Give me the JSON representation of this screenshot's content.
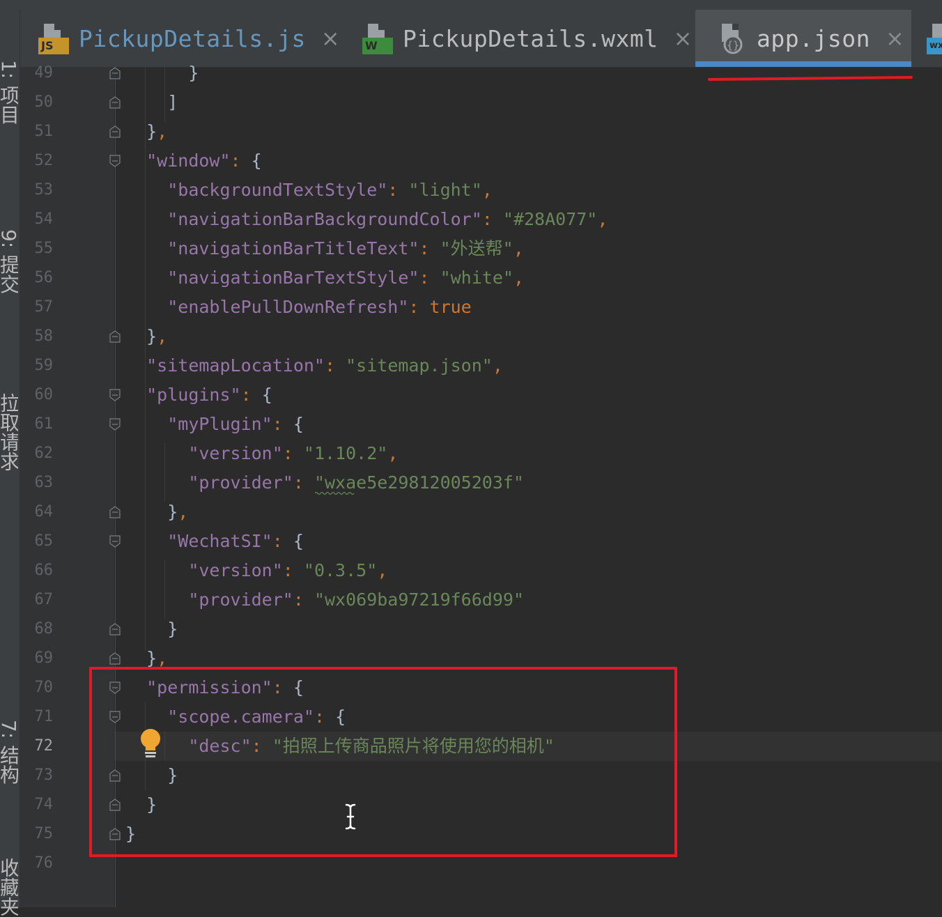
{
  "tabs": [
    {
      "label": "PickupDetails.js",
      "badge": "JS",
      "badge_color": "#c4932a",
      "close": "×"
    },
    {
      "label": "PickupDetails.wxml",
      "badge": "W",
      "badge_color": "#3d8b3d",
      "close": "×"
    },
    {
      "label": "app.json",
      "badge": "",
      "active": true,
      "close": "×"
    },
    {
      "label": "",
      "badge": "wx",
      "badge_color": "#3a96c8"
    }
  ],
  "sidebar": {
    "labels": [
      "1: 项目",
      "9: 提交",
      "拉取请求",
      "7: 结构",
      "收藏夹"
    ]
  },
  "editor": {
    "current_line": 72,
    "lines": [
      {
        "n": "49",
        "code": "      }"
      },
      {
        "n": "50",
        "code": "    ]"
      },
      {
        "n": "51",
        "code": "  },"
      },
      {
        "n": "52",
        "code": "  \"window\": {"
      },
      {
        "n": "53",
        "code": "    \"backgroundTextStyle\": \"light\","
      },
      {
        "n": "54",
        "code": "    \"navigationBarBackgroundColor\": \"#28A077\","
      },
      {
        "n": "55",
        "code": "    \"navigationBarTitleText\": \"外送帮\","
      },
      {
        "n": "56",
        "code": "    \"navigationBarTextStyle\": \"white\","
      },
      {
        "n": "57",
        "code": "    \"enablePullDownRefresh\": true"
      },
      {
        "n": "58",
        "code": "  },"
      },
      {
        "n": "59",
        "code": "  \"sitemapLocation\": \"sitemap.json\","
      },
      {
        "n": "60",
        "code": "  \"plugins\": {"
      },
      {
        "n": "61",
        "code": "    \"myPlugin\": {"
      },
      {
        "n": "62",
        "code": "      \"version\": \"1.10.2\","
      },
      {
        "n": "63",
        "code": "      \"provider\": \"wxae5e29812005203f\""
      },
      {
        "n": "64",
        "code": "    },"
      },
      {
        "n": "65",
        "code": "    \"WechatSI\": {"
      },
      {
        "n": "66",
        "code": "      \"version\": \"0.3.5\","
      },
      {
        "n": "67",
        "code": "      \"provider\": \"wx069ba97219f66d99\""
      },
      {
        "n": "68",
        "code": "    }"
      },
      {
        "n": "69",
        "code": "  },"
      },
      {
        "n": "70",
        "code": "  \"permission\": {"
      },
      {
        "n": "71",
        "code": "    \"scope.camera\": {"
      },
      {
        "n": "72",
        "code": "      \"desc\": \"拍照上传商品照片将使用您的相机\""
      },
      {
        "n": "73",
        "code": "    }"
      },
      {
        "n": "74",
        "code": "  }"
      },
      {
        "n": "75",
        "code": "}"
      },
      {
        "n": "76",
        "code": ""
      }
    ]
  },
  "colors": {
    "highlight_box": "#e01b23",
    "active_tab_underline": "#4a88c7",
    "bulb": "#f0a732"
  }
}
